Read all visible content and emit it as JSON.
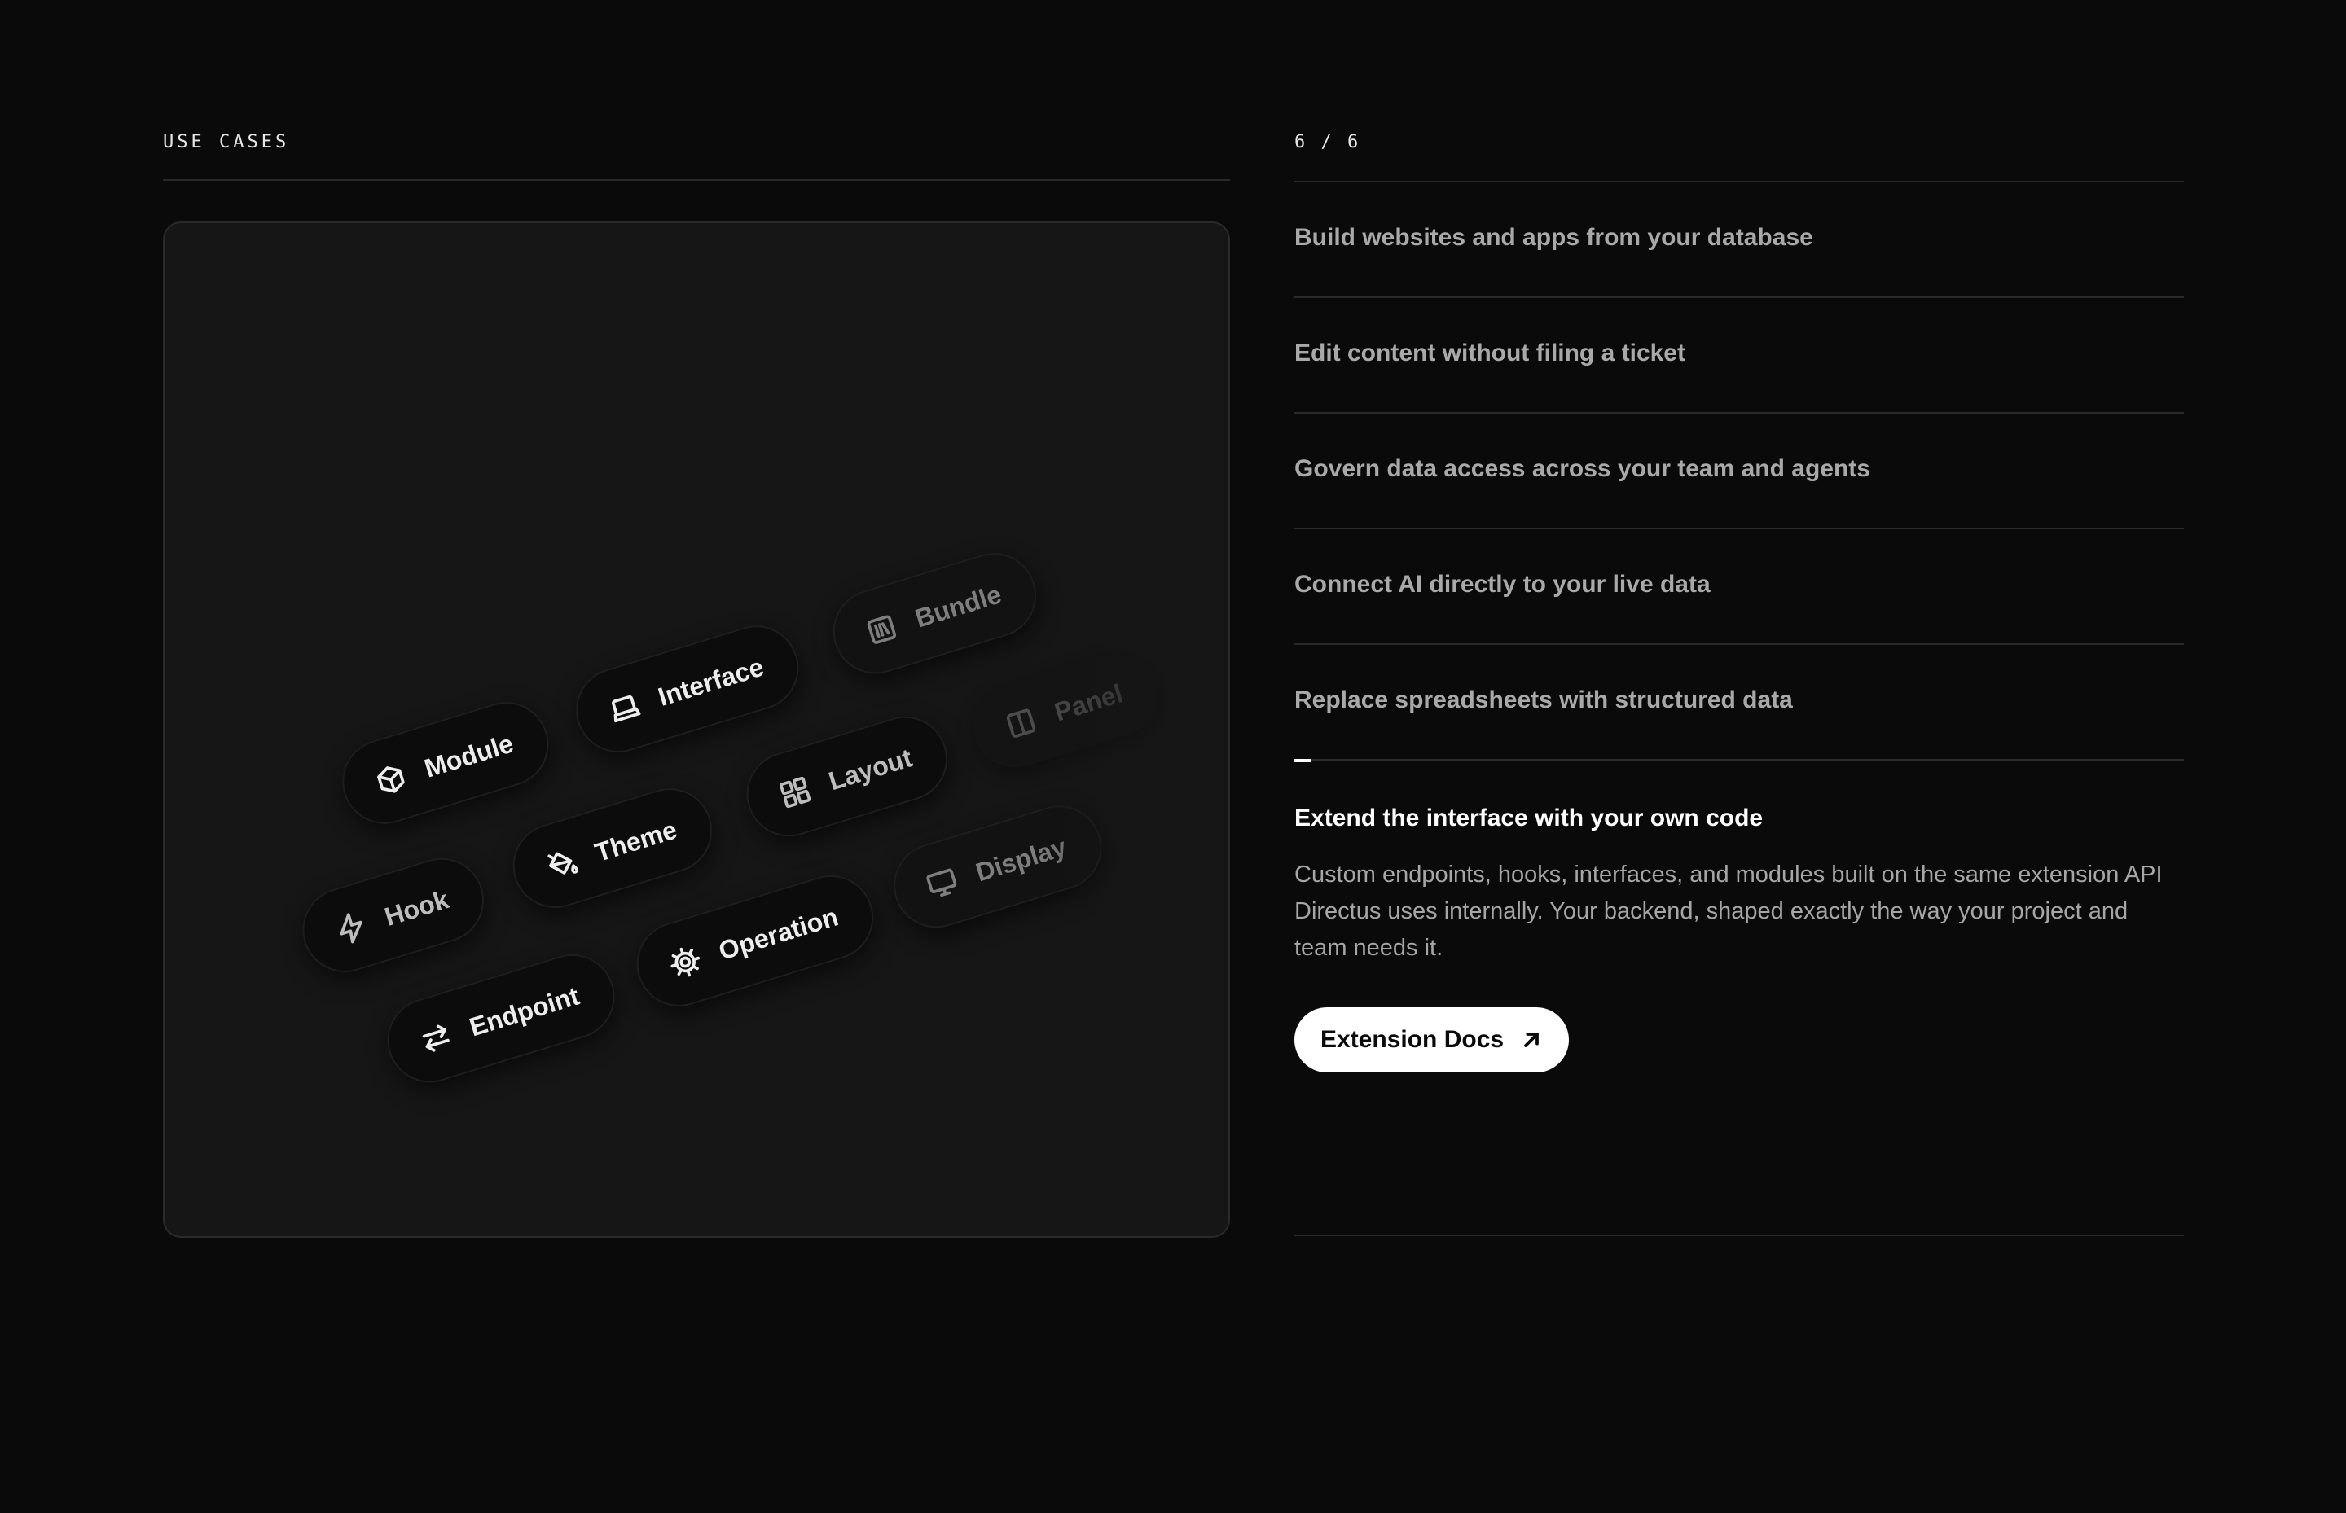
{
  "section_label": "USE CASES",
  "counter": "6 / 6",
  "chips": [
    {
      "label": "Module",
      "icon": "cube-icon"
    },
    {
      "label": "Interface",
      "icon": "laptop-icon"
    },
    {
      "label": "Bundle",
      "icon": "library-icon"
    },
    {
      "label": "Hook",
      "icon": "lightning-icon"
    },
    {
      "label": "Theme",
      "icon": "paint-bucket-icon"
    },
    {
      "label": "Layout",
      "icon": "layout-grid-icon"
    },
    {
      "label": "Panel",
      "icon": "panel-icon"
    },
    {
      "label": "Endpoint",
      "icon": "arrows-swap-icon"
    },
    {
      "label": "Operation",
      "icon": "cog-icon"
    },
    {
      "label": "Display",
      "icon": "monitor-icon"
    }
  ],
  "use_cases": [
    "Build websites and apps from your database",
    "Edit content without filing a ticket",
    "Govern data access across your team and agents",
    "Connect AI directly to your live data",
    "Replace spreadsheets with structured data"
  ],
  "active_case": {
    "title": "Extend the interface with your own code",
    "description": "Custom endpoints, hooks, interfaces, and modules built on the same extension API Directus uses internally. Your backend, shaped exactly the way your project and team needs it.",
    "button_label": "Extension Docs",
    "button_icon": "arrow-up-right-icon"
  },
  "colors": {
    "background": "#0a0a0a",
    "panel": "#161616",
    "chip": "#0c0c0c",
    "divider": "#2a2a2a",
    "muted_text": "#a9a9a9",
    "button_bg": "#ffffff"
  }
}
